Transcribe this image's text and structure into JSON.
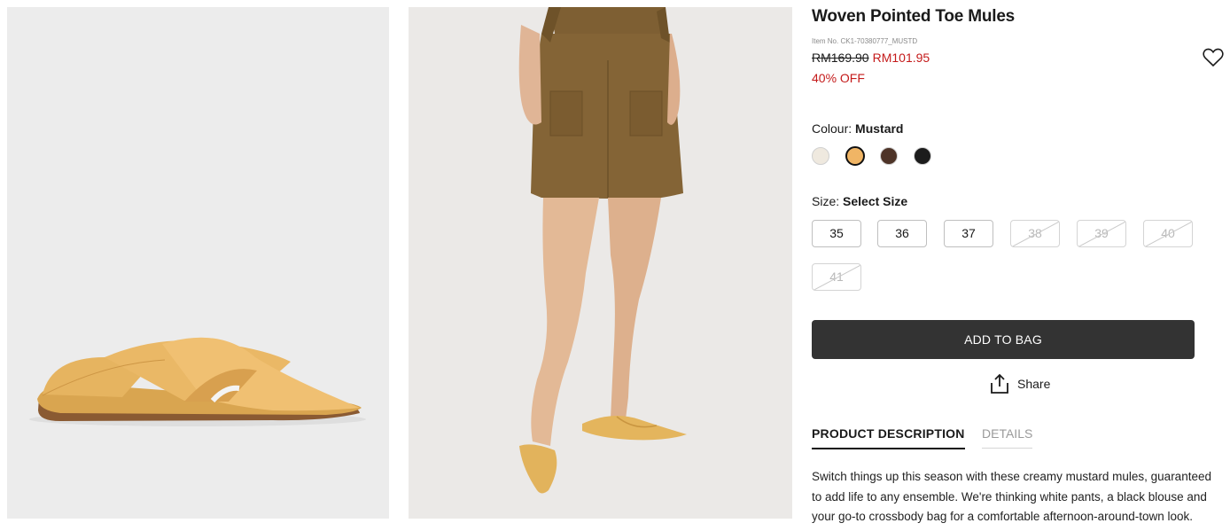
{
  "product": {
    "title": "Woven Pointed Toe Mules",
    "item_no": "Item No. CK1-70380777_MUSTD",
    "price_original": "RM169.90",
    "price_sale": "RM101.95",
    "discount": "40% OFF"
  },
  "colour": {
    "label": "Colour:",
    "selected": "Mustard",
    "swatches": [
      {
        "color": "#efe9df",
        "selected": false
      },
      {
        "color": "#f0b565",
        "selected": true
      },
      {
        "color": "#4e3428",
        "selected": false
      },
      {
        "color": "#1c1c1c",
        "selected": false
      }
    ]
  },
  "size": {
    "label": "Size:",
    "selected": "Select Size",
    "options": [
      {
        "label": "35",
        "available": true
      },
      {
        "label": "36",
        "available": true
      },
      {
        "label": "37",
        "available": true
      },
      {
        "label": "38",
        "available": false
      },
      {
        "label": "39",
        "available": false
      },
      {
        "label": "40",
        "available": false
      },
      {
        "label": "41",
        "available": false
      }
    ]
  },
  "actions": {
    "add_to_bag": "ADD TO BAG",
    "share": "Share"
  },
  "tabs": {
    "description": "PRODUCT DESCRIPTION",
    "details": "DETAILS"
  },
  "description": "Switch things up this season with these creamy mustard mules, guaranteed to add life to any ensemble. We're thinking white pants, a black blouse and your go-to crossbody bag for a comfortable afternoon-around-town look.",
  "icons": {
    "wishlist": "heart-outline-icon",
    "share": "share-upload-icon"
  }
}
